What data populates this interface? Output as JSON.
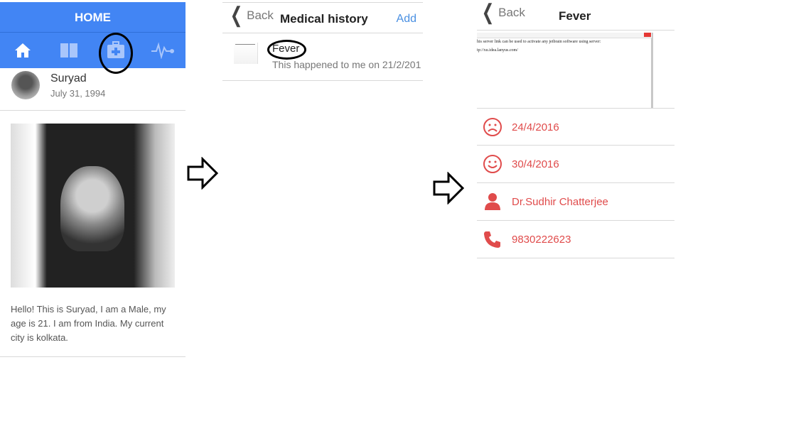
{
  "panel1": {
    "header_title": "HOME",
    "tabs": [
      {
        "icon": "home-icon"
      },
      {
        "icon": "book-icon"
      },
      {
        "icon": "medical-kit-icon"
      },
      {
        "icon": "pulse-icon"
      }
    ],
    "profile": {
      "name": "Suryad",
      "dob": "July 31, 1994"
    },
    "bio": "Hello! This is Suryad, I am a Male, my age is 21. I am from India. My current city is kolkata."
  },
  "panel2": {
    "back_label": "Back",
    "title": "Medical history",
    "add_label": "Add",
    "item": {
      "title": "Fever",
      "subtitle": "This happened to me on 21/2/201"
    }
  },
  "panel3": {
    "back_label": "Back",
    "title": "Fever",
    "attachment_text_line1": "his server link can be used to activate any jetbrain software using server:",
    "attachment_text_line2": "tp://xu.idea.lanyus.com/",
    "rows": [
      {
        "icon": "sad-face-icon",
        "text": "24/4/2016"
      },
      {
        "icon": "happy-face-icon",
        "text": "30/4/2016"
      },
      {
        "icon": "doctor-person-icon",
        "text": "Dr.Sudhir Chatterjee"
      },
      {
        "icon": "phone-icon",
        "text": "9830222623"
      }
    ]
  },
  "colors": {
    "primary": "#4285f4",
    "accent_red": "#e04b4b",
    "link_blue": "#4a90e2"
  }
}
